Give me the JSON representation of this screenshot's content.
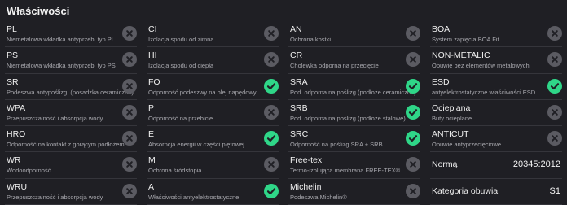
{
  "section_title": "Właściwości",
  "columns": [
    [
      {
        "code": "PL",
        "desc": "Niemetalowa wkładka antyprzeb. typ PL",
        "status": "no"
      },
      {
        "code": "PS",
        "desc": "Niemetalowa wkładka antyprzeb. typ PS",
        "status": "no"
      },
      {
        "code": "SR",
        "desc": "Podeszwa antypoślizg. (posadzka ceramiczna)",
        "status": "no"
      },
      {
        "code": "WPA",
        "desc": "Przepuszczalność i absorpcja wody",
        "status": "no"
      },
      {
        "code": "HRO",
        "desc": "Odporność na kontakt z gorącym podłożem",
        "status": "no"
      },
      {
        "code": "WR",
        "desc": "Wodoodporność",
        "status": "no"
      },
      {
        "code": "WRU",
        "desc": "Przepuszczalność i absorpcja wody",
        "status": "no"
      }
    ],
    [
      {
        "code": "CI",
        "desc": "Izolacja spodu od zimna",
        "status": "no"
      },
      {
        "code": "HI",
        "desc": "Izolacja spodu od ciepła",
        "status": "no"
      },
      {
        "code": "FO",
        "desc": "Odporność podeszwy na olej napędowy",
        "status": "yes"
      },
      {
        "code": "P",
        "desc": "Odporność na przebicie",
        "status": "no"
      },
      {
        "code": "E",
        "desc": "Absorpcja energii w części piętowej",
        "status": "yes"
      },
      {
        "code": "M",
        "desc": "Ochrona śródstopia",
        "status": "no"
      },
      {
        "code": "A",
        "desc": "Właściwości antyelektrostatyczne",
        "status": "yes"
      }
    ],
    [
      {
        "code": "AN",
        "desc": "Ochrona kostki",
        "status": "no"
      },
      {
        "code": "CR",
        "desc": "Cholewka odporna na przecięcie",
        "status": "no"
      },
      {
        "code": "SRA",
        "desc": "Pod. odporna na poślizg (podłoże ceramiczne)",
        "status": "yes"
      },
      {
        "code": "SRB",
        "desc": "Pod. odporna na poślizg (podłoże stalowe)",
        "status": "yes"
      },
      {
        "code": "SRC",
        "desc": "Odporność na poślizg SRA + SRB",
        "status": "yes"
      },
      {
        "code": "Free-tex",
        "desc": "Termo-izolująca membrana FREE-TEX®",
        "status": "no"
      },
      {
        "code": "Michelin",
        "desc": "Podeszwa Michelin®",
        "status": "no"
      }
    ],
    [
      {
        "code": "BOA",
        "desc": "System zapięcia BOA Fit",
        "status": "no"
      },
      {
        "code": "NON-METALIC",
        "desc": "Obuwie bez elementów metalowych",
        "status": "no"
      },
      {
        "code": "ESD",
        "desc": "antyelektrostatyczne właściwości ESD",
        "status": "yes"
      },
      {
        "code": "Ocieplana",
        "desc": "Buty ocieplane",
        "status": "no"
      },
      {
        "code": "ANTICUT",
        "desc": "Obuwie antyprzecięciowe",
        "status": "no"
      },
      {
        "code": "Normą",
        "value": "20345:2012",
        "status": "spec"
      },
      {
        "code": "Kategoria obuwia",
        "value": "S1",
        "status": "spec"
      }
    ]
  ],
  "colors": {
    "background": "#1f1f24",
    "yes": "#2fd688",
    "no": "#5b5b62"
  },
  "icons": {
    "yes": "check-circle-icon",
    "no": "x-circle-icon"
  }
}
